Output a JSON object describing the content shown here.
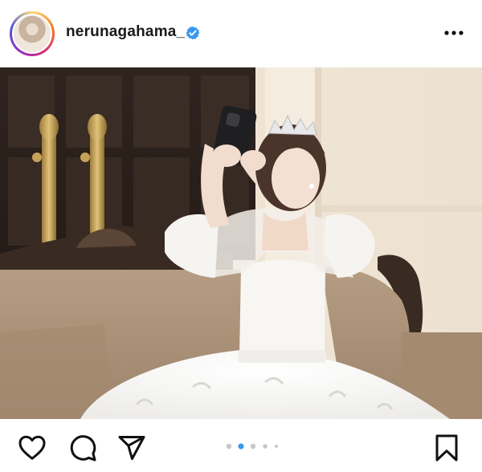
{
  "post": {
    "username": "nerunagahama_",
    "verified": true,
    "carousel": {
      "total_dots": 5,
      "active_index": 1
    }
  },
  "icons": {
    "header": [
      "verified-badge-icon",
      "more-options-icon"
    ],
    "actions": [
      "heart-icon",
      "comment-icon",
      "share-icon",
      "bookmark-icon"
    ]
  },
  "colors": {
    "verified_blue": "#3897f0",
    "active_dot": "#3897f0",
    "inactive_dot": "#c7c7c7"
  }
}
